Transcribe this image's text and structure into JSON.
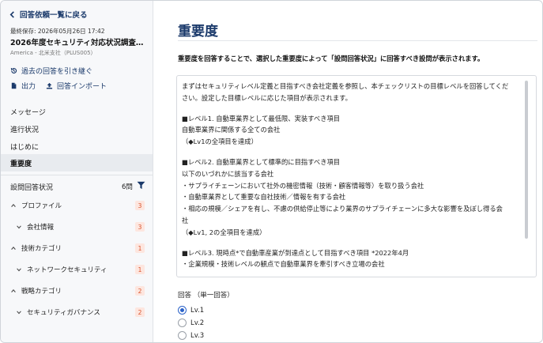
{
  "sidebar": {
    "back_label": "回答依頼一覧に戻る",
    "saved_at": "最終保存: 2026年05月26日 17:42",
    "survey_title": "2026年度セキュリティ対応状況調査の…",
    "company": "America - 北米支社（PLUS005）",
    "actions": {
      "inherit": "過去の回答を引き継ぐ",
      "export": "出力",
      "import": "回答インポート"
    },
    "nav": {
      "message": "メッセージ",
      "progress": "進行状況",
      "intro": "はじめに",
      "importance": "重要度"
    },
    "status": {
      "title": "設問回答状況",
      "count": "6問"
    },
    "tree": [
      {
        "label": "プロファイル",
        "badge": "3"
      },
      {
        "label": "会社情報",
        "badge": "3"
      },
      {
        "label": "技術カテゴリ",
        "badge": "1"
      },
      {
        "label": "ネットワークセキュリティ",
        "badge": "1"
      },
      {
        "label": "戦略カテゴリ",
        "badge": "2"
      },
      {
        "label": "セキュリティガバナンス",
        "badge": "2"
      }
    ]
  },
  "main": {
    "title": "重要度",
    "lead": "重要度を回答することで、選択した重要度によって「設問回答状況」に回答すべき設問が表示されます。",
    "desc": {
      "l1": "まずはセキュリティレベル定義と目指すべき会社定義を参照し、本チェックリストの目標レベルを回答してくだ",
      "l2": "さい。設定した目標レベルに応じた項目が表示されます。",
      "l3": "■レベル1. 自動車業界として最低限、実装すべき項目",
      "l4": "自動車業界に関係する全ての会社",
      "l5": "（◆Lv1の全項目を達成）",
      "l6": "■レベル2. 自動車業界として標準的に目指すべき項目",
      "l7": "以下のいづれかに該当する会社",
      "l8": "・サプライチェーンにおいて社外の機密情報（技術・顧客情報等）を取り扱う会社",
      "l9": "・自動車業界として重要な自社技術／情報を有する会社",
      "l10": "・相応の規模／シェアを有し、不慮の供給停止等により業界のサプライチェーンに多大な影響を及ぼし得る会",
      "l11": "社",
      "l12": "（◆Lv1, 2の全項目を達成）",
      "l13": "■レベル3. 現時点*で自動車産業が到達点として目指すべき項目 *2022年4月",
      "l14": "・企業規模・技術レベルの観点で自動車業界を牽引すべき立場の会社"
    },
    "answer_label": "回答 （単一回答）",
    "options": [
      "Lv.1",
      "Lv.2",
      "Lv.3"
    ],
    "selected": "Lv.1"
  },
  "colors": {
    "accent": "#1b3a6b",
    "radio": "#2b62c8",
    "badge_bg": "#fde6df",
    "badge_text": "#d9532c"
  }
}
